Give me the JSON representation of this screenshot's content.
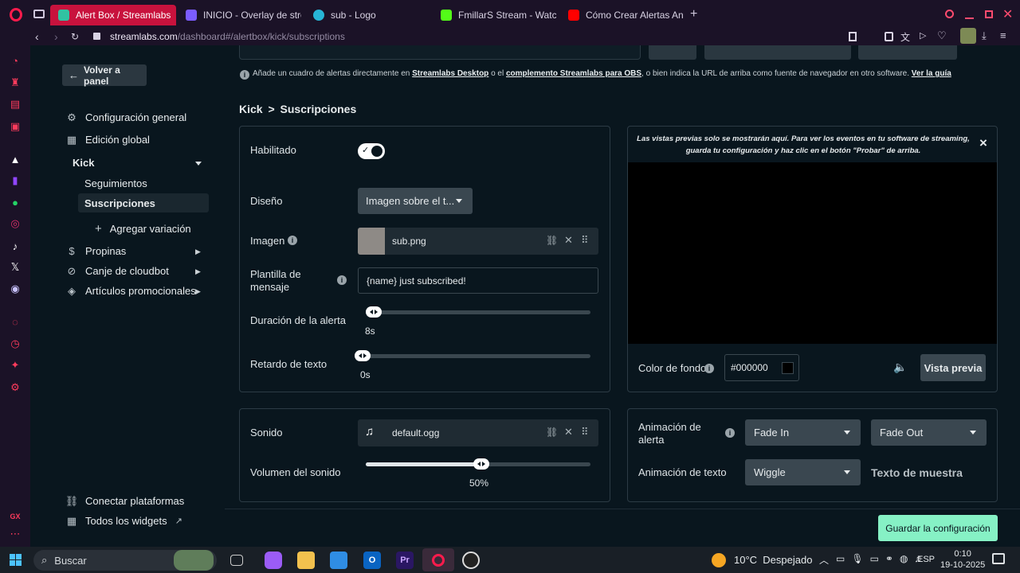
{
  "browser": {
    "tabs": [
      {
        "title": "Alert Box / Streamlabs",
        "active": true,
        "icon": "streamlabs-icon",
        "color": "#31c3a2"
      },
      {
        "title": "INICIO - Overlay de strea",
        "active": false,
        "icon": "video-icon",
        "color": "#7b5cff"
      },
      {
        "title": "sub - Logo",
        "active": false,
        "icon": "canva-icon",
        "color": "#27b5d6"
      },
      {
        "title": "FmillarS Stream - Watch",
        "active": false,
        "icon": "kick-icon",
        "color": "#53fc18"
      },
      {
        "title": "Cómo Crear Alertas Anim",
        "active": false,
        "icon": "youtube-icon",
        "color": "#ff0000"
      }
    ],
    "new_tab_label": "+",
    "url_domain": "streamlabs.com",
    "url_path": "/dashboard#/alertbox/kick/subscriptions"
  },
  "top_hint": {
    "text_1": "Añade un cuadro de alertas directamente en ",
    "link_1": "Streamlabs Desktop",
    "text_2": " o el ",
    "link_2": "complemento Streamlabs para OBS",
    "text_3": ", o bien indica la URL de arriba como fuente de navegador en otro software. ",
    "link_3": "Ver la guía"
  },
  "sidebar": {
    "back_button": "Volver a panel",
    "items": [
      {
        "label": "Configuración general",
        "icon": "gear-icon"
      },
      {
        "label": "Edición global",
        "icon": "grid-icon"
      }
    ],
    "kick_section": "Kick",
    "kick_items": [
      {
        "label": "Seguimientos",
        "selected": false
      },
      {
        "label": "Suscripciones",
        "selected": true
      }
    ],
    "add_variation": "Agregar variación",
    "collapsible": [
      {
        "label": "Propinas",
        "icon": "dollar-icon"
      },
      {
        "label": "Canje de cloudbot",
        "icon": "link-icon"
      },
      {
        "label": "Artículos promocionales",
        "icon": "tag-icon"
      }
    ],
    "bottom": [
      {
        "label": "Conectar plataformas",
        "icon": "link-icon"
      },
      {
        "label": "Todos los widgets",
        "icon": "widgets-icon"
      }
    ]
  },
  "breadcrumb": {
    "parent": "Kick",
    "sep": ">",
    "current": "Suscripciones"
  },
  "settings": {
    "enabled_label": "Habilitado",
    "enabled": true,
    "layout_label": "Diseño",
    "layout_value": "Imagen sobre el t...",
    "image_label": "Imagen",
    "image_file": "sub.png",
    "template_label_1": "Plantilla de",
    "template_label_2": "mensaje",
    "template_value": "{name} just subscribed!",
    "duration_label": "Duración de la alerta",
    "duration_value": "8s",
    "duration_fraction": 0.02,
    "text_delay_label": "Retardo de texto",
    "text_delay_value": "0s",
    "text_delay_fraction": 0.0
  },
  "preview": {
    "notice_1": "Las vistas previas solo se mostrarán aquí. Para ver los eventos en tu software de streaming,",
    "notice_2": "guarda tu configuración y haz clic en el botón \"Probar\" de arriba.",
    "close": "×",
    "bg_label": "Color de fondo",
    "bg_value": "#000000",
    "preview_button": "Vista previa"
  },
  "sound": {
    "label": "Sonido",
    "file": "default.ogg",
    "volume_label": "Volumen del sonido",
    "volume_value": "50%",
    "volume_fraction": 0.5
  },
  "animation": {
    "alert_label_1": "Animación de",
    "alert_label_2": "alerta",
    "in_value": "Fade In",
    "out_value": "Fade Out",
    "text_label": "Animación de texto",
    "text_value": "Wiggle",
    "sample_text": "Texto de muestra"
  },
  "save_button": "Guardar la configuración",
  "taskbar": {
    "search_placeholder": "Buscar",
    "weather": "10°C  Despejado",
    "language": "ESP",
    "time": "0:10",
    "date": "19-10-2025"
  },
  "colors": {
    "accent": "#86f1c5",
    "tab_active": "#c8123d"
  }
}
